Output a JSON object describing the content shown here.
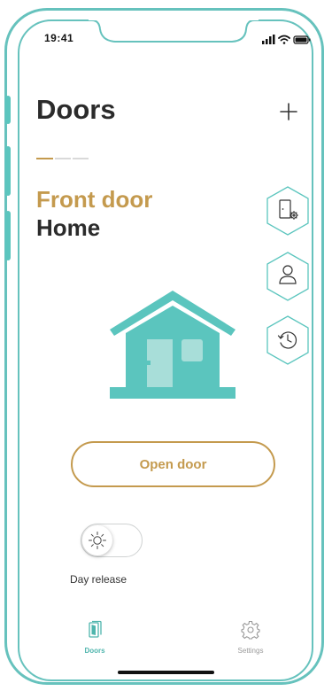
{
  "status_bar": {
    "time": "19:41"
  },
  "header": {
    "title": "Doors",
    "add_icon": "plus-icon"
  },
  "pager": {
    "active_color": "#c49a4e",
    "inactive_color": "#d9d9d9"
  },
  "door": {
    "name": "Front door",
    "location": "Home"
  },
  "side_actions": [
    {
      "icon": "door-settings-icon"
    },
    {
      "icon": "user-icon"
    },
    {
      "icon": "history-icon"
    }
  ],
  "actions": {
    "open_door_label": "Open door"
  },
  "day_release": {
    "label": "Day release",
    "enabled": false,
    "icon": "sun-icon"
  },
  "bottom_nav": {
    "items": [
      {
        "label": "Doors",
        "icon": "doors-icon",
        "active": true
      },
      {
        "label": "Settings",
        "icon": "gear-icon",
        "active": false
      }
    ]
  },
  "colors": {
    "teal": "#5bc5be",
    "gold": "#c49a4e",
    "text_dark": "#2b2b2b"
  }
}
